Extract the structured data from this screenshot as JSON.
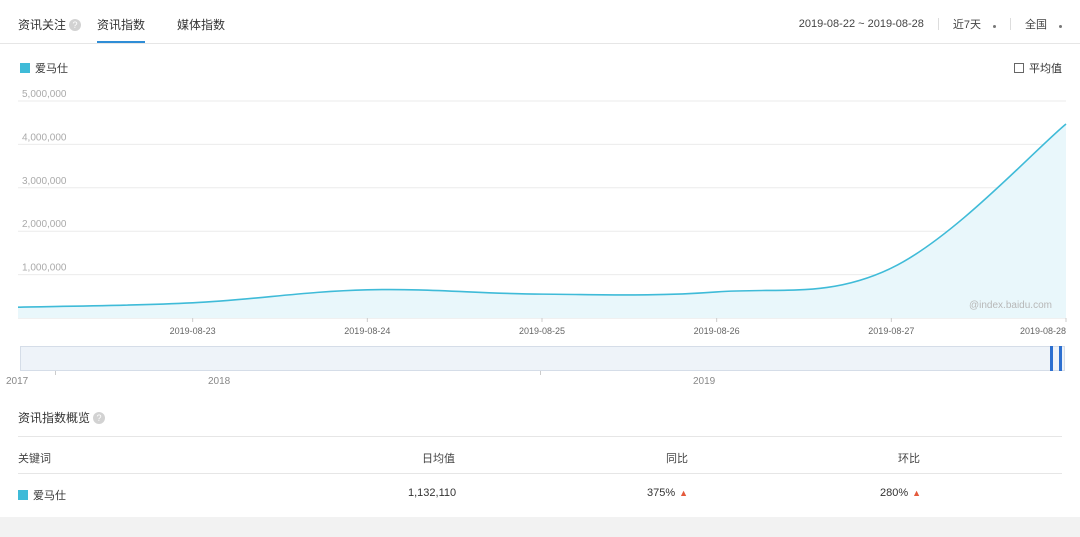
{
  "header": {
    "section_title": "资讯关注",
    "tabs": [
      {
        "label": "资讯指数",
        "active": true
      },
      {
        "label": "媒体指数",
        "active": false
      }
    ],
    "date_range": "2019-08-22 ~ 2019-08-28",
    "period": "近7天",
    "region": "全国"
  },
  "legend": {
    "keyword": "爱马仕",
    "color": "#3fbbd8"
  },
  "avg_toggle": {
    "label": "平均值",
    "checked": false
  },
  "watermark": "@index.baidu.com",
  "chart_data": {
    "type": "area",
    "x": [
      "2019-08-22",
      "2019-08-23",
      "2019-08-24",
      "2019-08-25",
      "2019-08-26",
      "2019-08-27",
      "2019-08-28"
    ],
    "series": [
      {
        "name": "爱马仕",
        "values": [
          250000,
          350000,
          650000,
          550000,
          600000,
          1150000,
          4470000
        ]
      }
    ],
    "y_ticks": [
      "1,000,000",
      "2,000,000",
      "3,000,000",
      "4,000,000",
      "5,000,000"
    ],
    "x_tick_labels": [
      "2019-08-23",
      "2019-08-24",
      "2019-08-25",
      "2019-08-26",
      "2019-08-27",
      "2019-08-28"
    ],
    "ylim": [
      0,
      5000000
    ],
    "grid": true
  },
  "timeline": {
    "years": [
      "2017",
      "2018",
      "2019"
    ]
  },
  "overview": {
    "title": "资讯指数概览",
    "columns": [
      "关键词",
      "日均值",
      "同比",
      "环比"
    ],
    "rows": [
      {
        "keyword": "爱马仕",
        "daily_avg": "1,132,110",
        "yoy": "375%",
        "mom": "280%"
      }
    ]
  }
}
